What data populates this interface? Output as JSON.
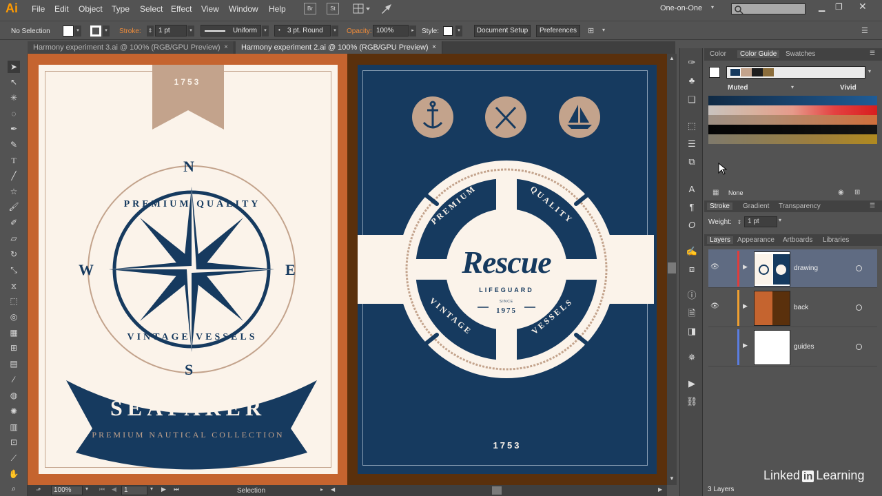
{
  "app": {
    "logo": "Ai",
    "workspace": "One-on-One"
  },
  "menu": {
    "items": [
      "File",
      "Edit",
      "Object",
      "Type",
      "Select",
      "Effect",
      "View",
      "Window",
      "Help"
    ],
    "icons": [
      "Br",
      "St"
    ]
  },
  "control_bar": {
    "selection": "No Selection",
    "stroke_label": "Stroke:",
    "stroke_weight": "1 pt",
    "profile": "Uniform",
    "brush": "3 pt. Round",
    "opacity_label": "Opacity:",
    "opacity": "100%",
    "style_label": "Style:",
    "document_setup": "Document Setup",
    "preferences": "Preferences"
  },
  "doc_tabs": [
    {
      "label": "Harmony experiment 3.ai @ 100% (RGB/GPU Preview)",
      "active": false
    },
    {
      "label": "Harmony experiment 2.ai @ 100% (RGB/GPU Preview)",
      "active": true
    }
  ],
  "close_glyph": "×",
  "artwork": {
    "left": {
      "ribbon_year": "1753",
      "compass_n": "N",
      "compass_s": "S",
      "compass_w": "W",
      "compass_e": "E",
      "arc_top": "PREMIUM QUALITY",
      "arc_bottom": "VINTAGE VESSELS",
      "banner": "SEAFARER",
      "tagline": "PREMIUM NAUTICAL COLLECTION"
    },
    "right": {
      "title": "Rescue",
      "subtitle": "LIFEGUARD",
      "since": "SINCE",
      "year": "1975",
      "arc_top_left": "PREMIUM",
      "arc_top_right": "QUALITY",
      "arc_bottom_left": "VINTAGE",
      "arc_bottom_right": "VESSELS",
      "footer_year": "1753"
    },
    "colors": {
      "navy": "#163a5f",
      "cream": "#fbf3ea",
      "tan": "#c3a38c",
      "orange": "#c5642f",
      "brown": "#5a300c"
    }
  },
  "status_bar": {
    "zoom": "100%",
    "artboard": "1",
    "mode": "Selection"
  },
  "color_panel": {
    "tabs": [
      "Color",
      "Color Guide",
      "Swatches"
    ],
    "active_tab": "Color Guide",
    "muted_label": "Muted",
    "vivid_label": "Vivid",
    "none_label": "None",
    "harmony_colors": [
      "#163a5f",
      "#c3a38c",
      "#1e1e1e",
      "#8b6d3b"
    ]
  },
  "stroke_panel": {
    "tabs": [
      "Stroke",
      "Gradient",
      "Transparency"
    ],
    "weight_label": "Weight:",
    "weight": "1 pt"
  },
  "layers_panel": {
    "tabs": [
      "Layers",
      "Appearance",
      "Artboards",
      "Libraries"
    ],
    "layers": [
      {
        "name": "drawing",
        "color": "#e03c3c",
        "selected": true
      },
      {
        "name": "back",
        "color": "#f0a030",
        "selected": false
      },
      {
        "name": "guides",
        "color": "#5a7de0",
        "selected": false
      }
    ],
    "count": "3 Layers"
  },
  "watermark": {
    "brand": "Linked",
    "in": "in",
    "suffix": "Learning"
  }
}
